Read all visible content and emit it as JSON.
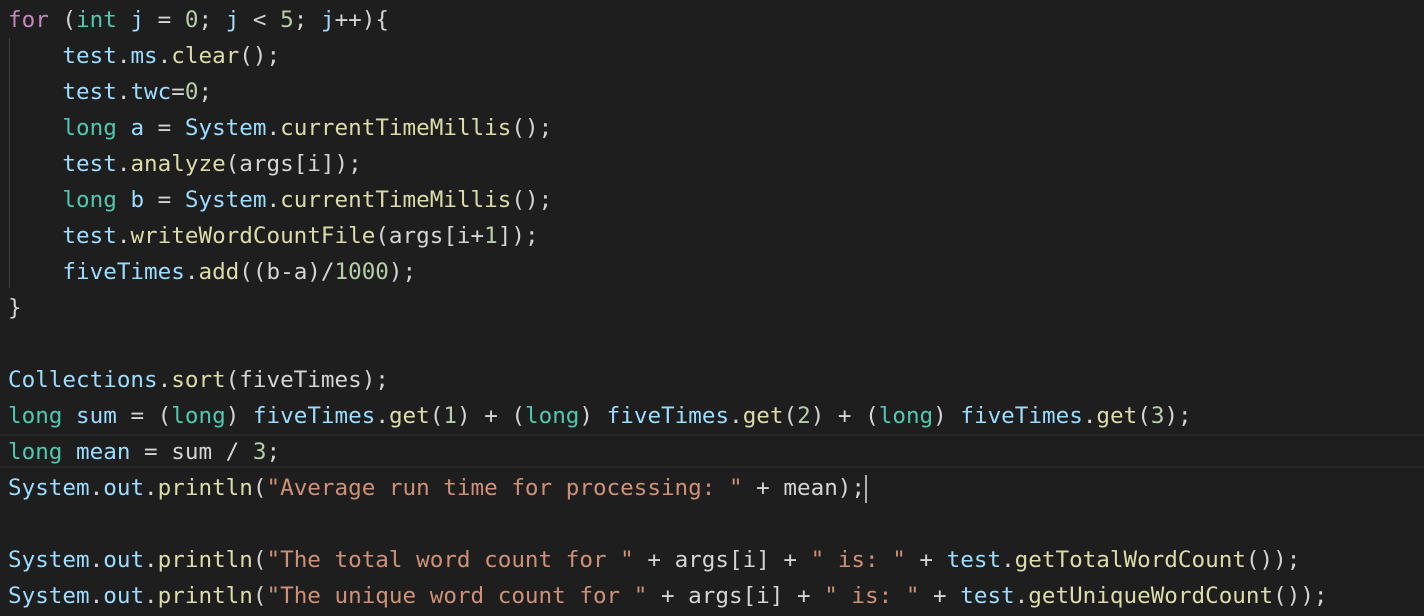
{
  "editor": {
    "language": "java",
    "theme": {
      "background": "#1e1e1e",
      "foreground": "#d4d4d4"
    },
    "colors": {
      "control_keyword": "#c586c0",
      "keyword": "#569cd6",
      "type": "#4ec9b0",
      "variable": "#9cdcfe",
      "function": "#dcdcaa",
      "number": "#b5cea8",
      "string": "#ce9178"
    },
    "cursor": {
      "line": 13
    },
    "lines": [
      [
        [
          "for",
          "kw-ctrl"
        ],
        [
          " (",
          "plain"
        ],
        [
          "int",
          "type"
        ],
        [
          " ",
          "plain"
        ],
        [
          "j",
          "var"
        ],
        [
          " = ",
          "plain"
        ],
        [
          "0",
          "num"
        ],
        [
          "; ",
          "plain"
        ],
        [
          "j",
          "var"
        ],
        [
          " < ",
          "plain"
        ],
        [
          "5",
          "num"
        ],
        [
          "; ",
          "plain"
        ],
        [
          "j",
          "var"
        ],
        [
          "++){",
          "plain"
        ]
      ],
      [
        [
          "    ",
          "plain"
        ],
        [
          "test",
          "var"
        ],
        [
          ".",
          "plain"
        ],
        [
          "ms",
          "var"
        ],
        [
          ".",
          "plain"
        ],
        [
          "clear",
          "fn"
        ],
        [
          "();",
          "plain"
        ]
      ],
      [
        [
          "    ",
          "plain"
        ],
        [
          "test",
          "var"
        ],
        [
          ".",
          "plain"
        ],
        [
          "twc",
          "var"
        ],
        [
          "=",
          "plain"
        ],
        [
          "0",
          "num"
        ],
        [
          ";",
          "plain"
        ]
      ],
      [
        [
          "    ",
          "plain"
        ],
        [
          "long",
          "type"
        ],
        [
          " ",
          "plain"
        ],
        [
          "a",
          "var"
        ],
        [
          " = ",
          "plain"
        ],
        [
          "System",
          "var"
        ],
        [
          ".",
          "plain"
        ],
        [
          "currentTimeMillis",
          "fn"
        ],
        [
          "();",
          "plain"
        ]
      ],
      [
        [
          "    ",
          "plain"
        ],
        [
          "test",
          "var"
        ],
        [
          ".",
          "plain"
        ],
        [
          "analyze",
          "fn"
        ],
        [
          "(args[i]);",
          "plain"
        ]
      ],
      [
        [
          "    ",
          "plain"
        ],
        [
          "long",
          "type"
        ],
        [
          " ",
          "plain"
        ],
        [
          "b",
          "var"
        ],
        [
          " = ",
          "plain"
        ],
        [
          "System",
          "var"
        ],
        [
          ".",
          "plain"
        ],
        [
          "currentTimeMillis",
          "fn"
        ],
        [
          "();",
          "plain"
        ]
      ],
      [
        [
          "    ",
          "plain"
        ],
        [
          "test",
          "var"
        ],
        [
          ".",
          "plain"
        ],
        [
          "writeWordCountFile",
          "fn"
        ],
        [
          "(args[i+",
          "plain"
        ],
        [
          "1",
          "num"
        ],
        [
          "]);",
          "plain"
        ]
      ],
      [
        [
          "    ",
          "plain"
        ],
        [
          "fiveTimes",
          "var"
        ],
        [
          ".",
          "plain"
        ],
        [
          "add",
          "fn"
        ],
        [
          "((b-a)/",
          "plain"
        ],
        [
          "1000",
          "num"
        ],
        [
          ");",
          "plain"
        ]
      ],
      [
        [
          "}",
          "plain"
        ]
      ],
      [],
      [
        [
          "Collections",
          "var"
        ],
        [
          ".",
          "plain"
        ],
        [
          "sort",
          "fn"
        ],
        [
          "(fiveTimes);",
          "plain"
        ]
      ],
      [
        [
          "long",
          "type"
        ],
        [
          " ",
          "plain"
        ],
        [
          "sum",
          "var"
        ],
        [
          " = (",
          "plain"
        ],
        [
          "long",
          "type"
        ],
        [
          ") ",
          "plain"
        ],
        [
          "fiveTimes",
          "var"
        ],
        [
          ".",
          "plain"
        ],
        [
          "get",
          "fn"
        ],
        [
          "(",
          "plain"
        ],
        [
          "1",
          "num"
        ],
        [
          ") + (",
          "plain"
        ],
        [
          "long",
          "type"
        ],
        [
          ") ",
          "plain"
        ],
        [
          "fiveTimes",
          "var"
        ],
        [
          ".",
          "plain"
        ],
        [
          "get",
          "fn"
        ],
        [
          "(",
          "plain"
        ],
        [
          "2",
          "num"
        ],
        [
          ") + (",
          "plain"
        ],
        [
          "long",
          "type"
        ],
        [
          ") ",
          "plain"
        ],
        [
          "fiveTimes",
          "var"
        ],
        [
          ".",
          "plain"
        ],
        [
          "get",
          "fn"
        ],
        [
          "(",
          "plain"
        ],
        [
          "3",
          "num"
        ],
        [
          ");",
          "plain"
        ]
      ],
      [
        [
          "long",
          "type"
        ],
        [
          " ",
          "plain"
        ],
        [
          "mean",
          "var"
        ],
        [
          " = sum / ",
          "plain"
        ],
        [
          "3",
          "num"
        ],
        [
          ";",
          "plain"
        ]
      ],
      [
        [
          "System",
          "var"
        ],
        [
          ".",
          "plain"
        ],
        [
          "out",
          "var"
        ],
        [
          ".",
          "plain"
        ],
        [
          "println",
          "fn"
        ],
        [
          "(",
          "plain"
        ],
        [
          "\"Average run time for processing: \"",
          "str"
        ],
        [
          " + mean);",
          "plain"
        ]
      ],
      [],
      [
        [
          "System",
          "var"
        ],
        [
          ".",
          "plain"
        ],
        [
          "out",
          "var"
        ],
        [
          ".",
          "plain"
        ],
        [
          "println",
          "fn"
        ],
        [
          "(",
          "plain"
        ],
        [
          "\"The total word count for \"",
          "str"
        ],
        [
          " + args[i] + ",
          "plain"
        ],
        [
          "\" is: \"",
          "str"
        ],
        [
          " + ",
          "plain"
        ],
        [
          "test",
          "var"
        ],
        [
          ".",
          "plain"
        ],
        [
          "getTotalWordCount",
          "fn"
        ],
        [
          "());",
          "plain"
        ]
      ],
      [
        [
          "System",
          "var"
        ],
        [
          ".",
          "plain"
        ],
        [
          "out",
          "var"
        ],
        [
          ".",
          "plain"
        ],
        [
          "println",
          "fn"
        ],
        [
          "(",
          "plain"
        ],
        [
          "\"The unique word count for \"",
          "str"
        ],
        [
          " + args[i] + ",
          "plain"
        ],
        [
          "\" is: \"",
          "str"
        ],
        [
          " + ",
          "plain"
        ],
        [
          "test",
          "var"
        ],
        [
          ".",
          "plain"
        ],
        [
          "getUniqueWordCount",
          "fn"
        ],
        [
          "());",
          "plain"
        ]
      ]
    ]
  }
}
